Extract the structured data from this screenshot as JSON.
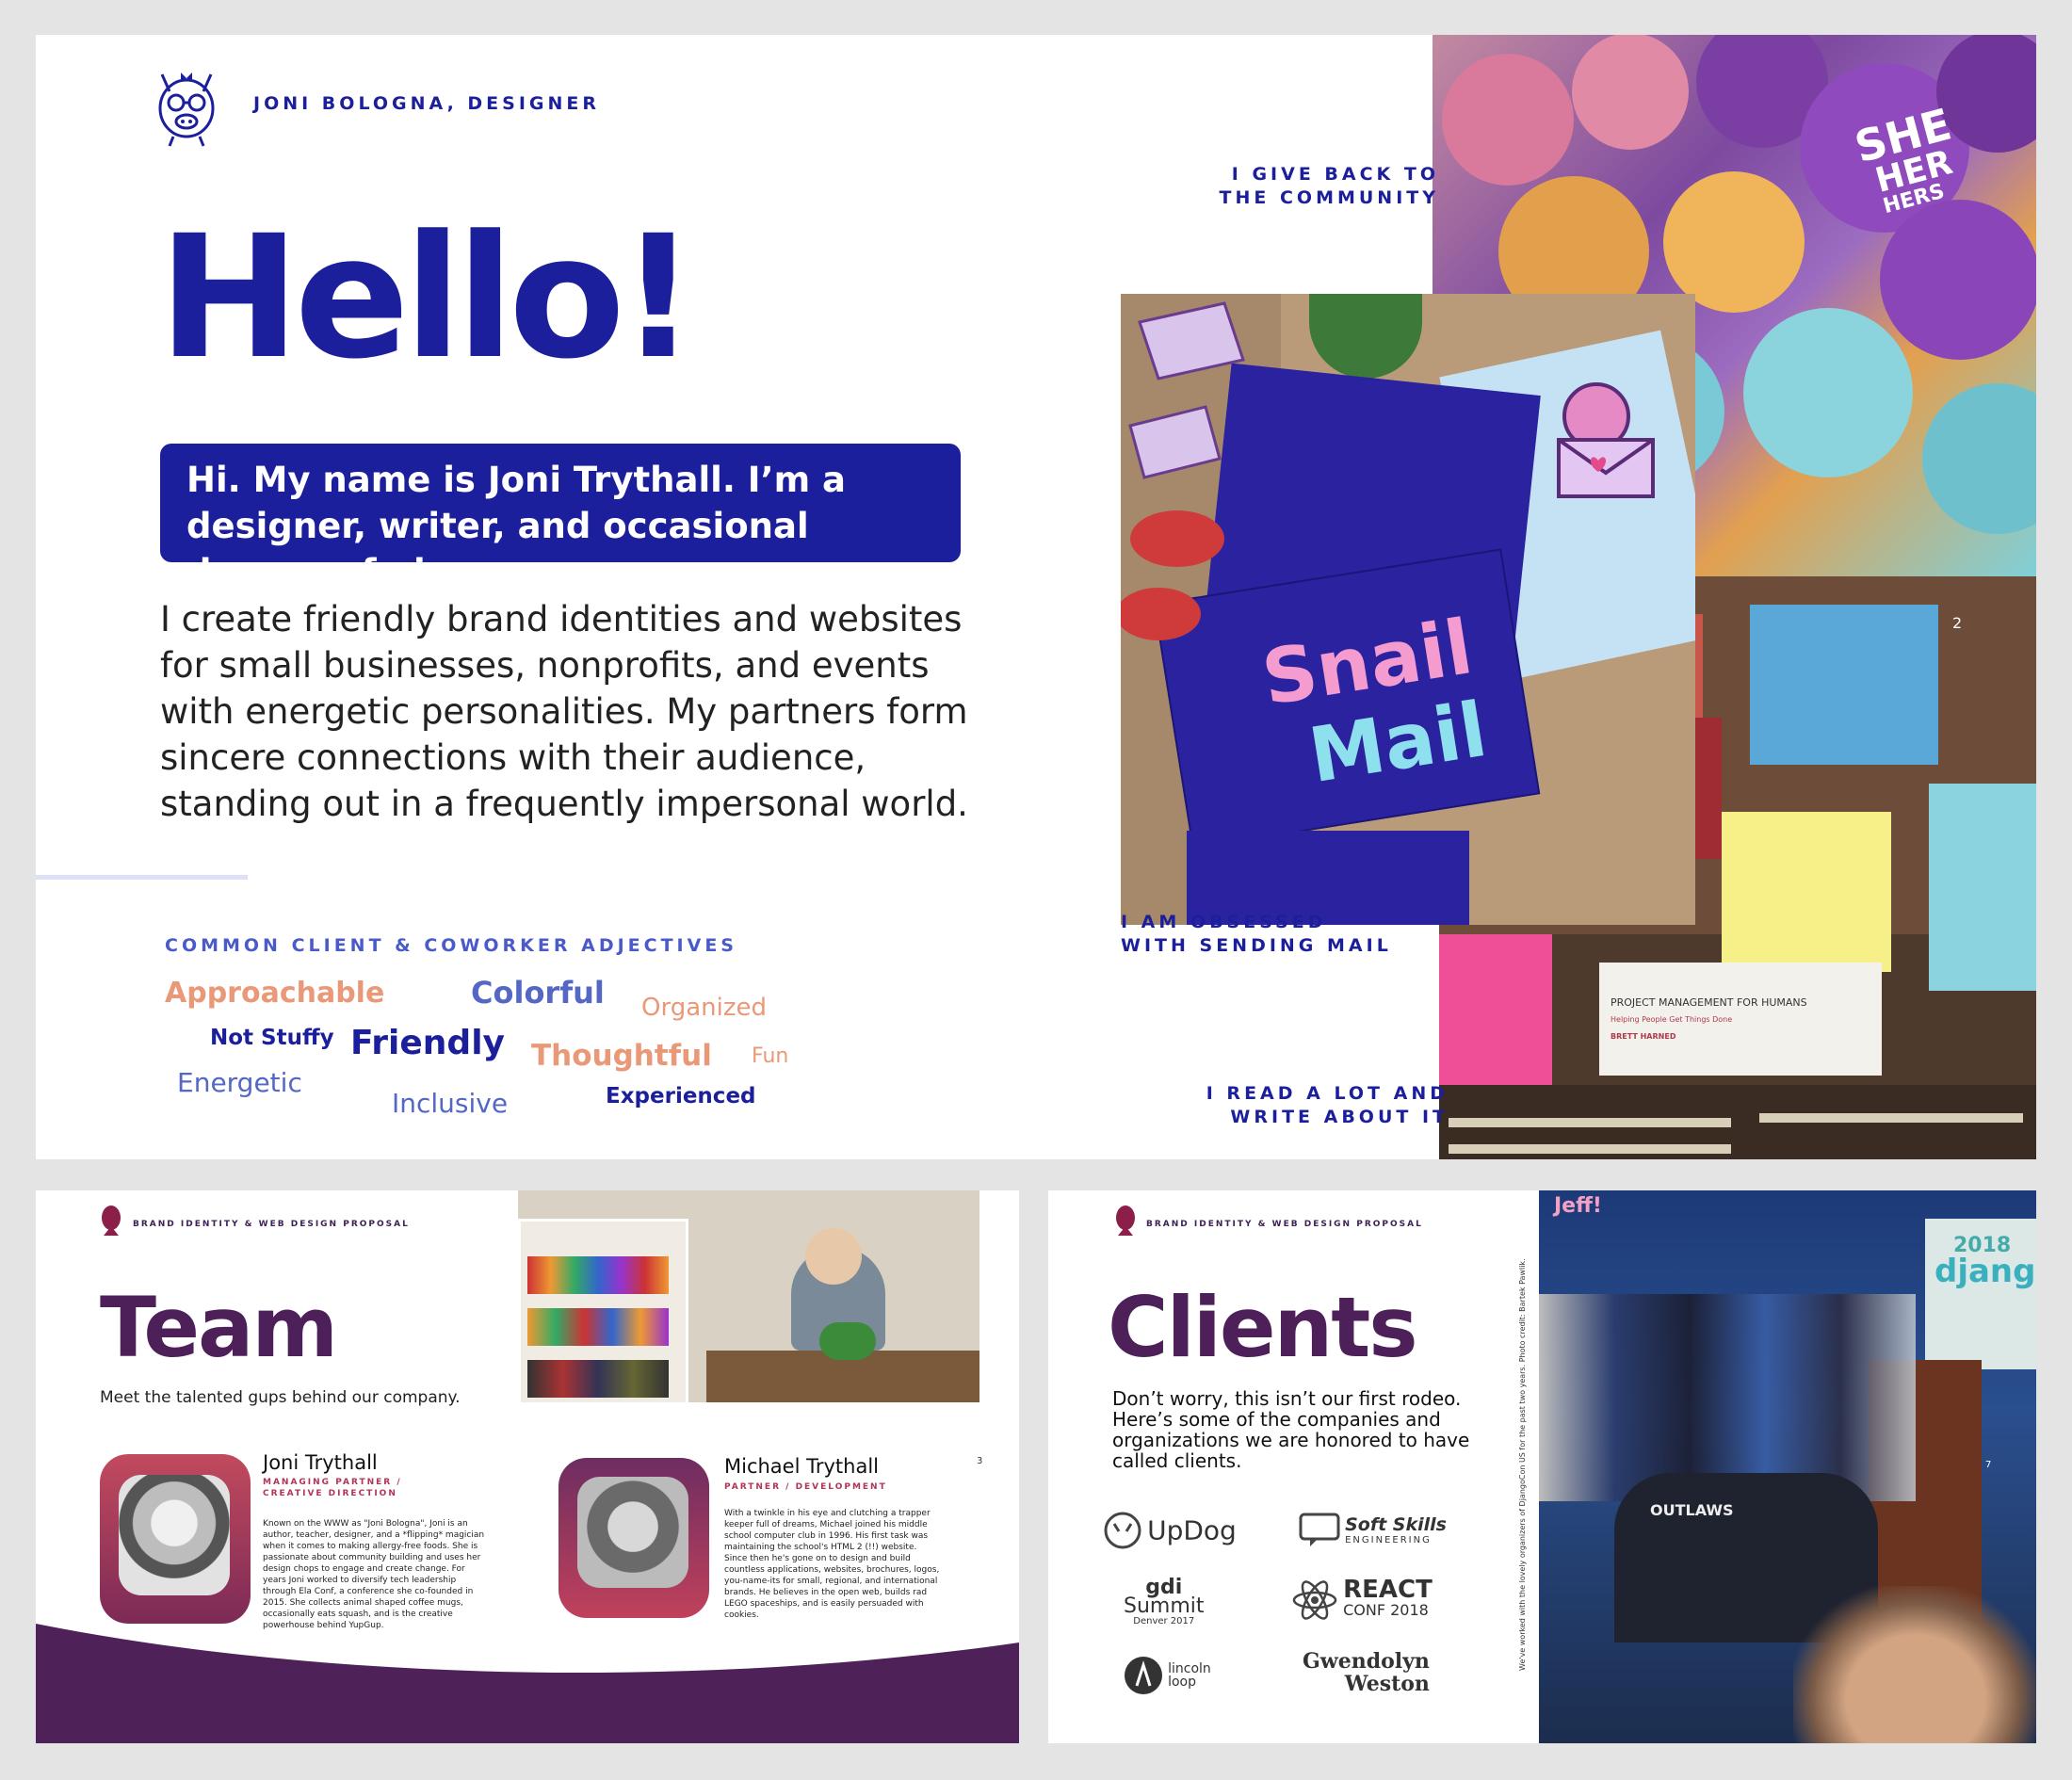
{
  "hello_slide": {
    "brand": "JONI BOLOGNA, DESIGNER",
    "headline": "Hello!",
    "intro": "Hi. My name is Joni Trythall. I’m a designer, writer, and occasional drawer of pigs.",
    "blurb": "I create friendly brand identities and websites for small businesses, nonprofits, and events with energetic personalities. My partners form sincere connections with their audience, standing out in a frequently impersonal world.",
    "adjectives_title": "COMMON CLIENT & COWORKER ADJECTIVES",
    "adjectives": [
      "Approachable",
      "Colorful",
      "Organized",
      "Not Stuffy",
      "Friendly",
      "Thoughtful",
      "Fun",
      "Energetic",
      "Inclusive",
      "Experienced"
    ],
    "photo_labels": {
      "community_1": "I GIVE BACK TO",
      "community_2": "THE COMMUNITY",
      "mail_1": "I AM OBSESSED",
      "mail_2": "WITH SENDING MAIL",
      "read_1": "I READ A LOT AND",
      "read_2": "WRITE ABOUT IT"
    },
    "photo_text": {
      "snail": "Snail",
      "mail": "Mail",
      "button_she": "SHE",
      "button_her": "HER",
      "button_hers": "HERS",
      "book_title": "PROJECT MANAGEMENT FOR HUMANS",
      "book_sub": "Helping People Get Things Done",
      "book_author": "BRETT HARNED",
      "page_number": "2"
    }
  },
  "team_slide": {
    "brand": "BRAND IDENTITY & WEB DESIGN PROPOSAL",
    "title": "Team",
    "subtitle": "Meet the talented gups behind our company.",
    "page_number": "3",
    "members": [
      {
        "name": "Joni Trythall",
        "role": "MANAGING PARTNER / CREATIVE DIRECTION",
        "bio": "Known on the WWW as \"Joni Bologna\", Joni is an author, teacher, designer, and a *flipping* magician when it comes to making allergy-free foods. She is passionate about community building and uses her design chops to engage and create change. For years Joni worked to diversify tech leadership through Ela Conf, a conference she co-founded in 2015. She collects animal shaped coffee mugs, occasionally eats squash, and is the creative powerhouse behind YupGup."
      },
      {
        "name": "Michael Trythall",
        "role": "PARTNER / DEVELOPMENT",
        "bio": "With a twinkle in his eye and clutching a trapper keeper full of dreams, Michael joined his middle school computer club in 1996. His first task was maintaining the school's HTML 2 (!!) website. Since then he's gone on to design and build countless applications, websites, brochures, logos, you-name-its for small, regional, and international brands. He believes in the open web, builds rad LEGO spaceships, and is easily persuaded with cookies."
      }
    ]
  },
  "clients_slide": {
    "brand": "BRAND IDENTITY & WEB DESIGN PROPOSAL",
    "title": "Clients",
    "blurb": "Don’t worry, this isn’t our first rodeo. Here’s some of the companies and organizations we are honored to have called clients.",
    "side_caption": "We've worked with the lovely organizers of DjangoCon US for the past two years. Photo credit: Bartek Pawlik.",
    "page_number": "7",
    "logos": {
      "updog": "UpDog",
      "softskills_1": "Soft Skills",
      "softskills_2": "ENGINEERING",
      "gdi_1": "gdi",
      "gdi_2": "Summit",
      "gdi_3": "Denver 2017",
      "react_1": "REACT",
      "react_2": "CONF 2018",
      "lincoln_1": "lincoln",
      "lincoln_2": "loop",
      "gwen_1": "Gwendolyn",
      "gwen_2": "Weston"
    },
    "photo_text": {
      "banner_year": "2018",
      "banner_word": "djang",
      "jeff": "Jeff!",
      "shirt": "OUTLAWS"
    }
  },
  "colors": {
    "navy": "#1c1f9b",
    "plum": "#4d2059",
    "salmon": "#e99878",
    "periwinkle": "#5467c5"
  }
}
